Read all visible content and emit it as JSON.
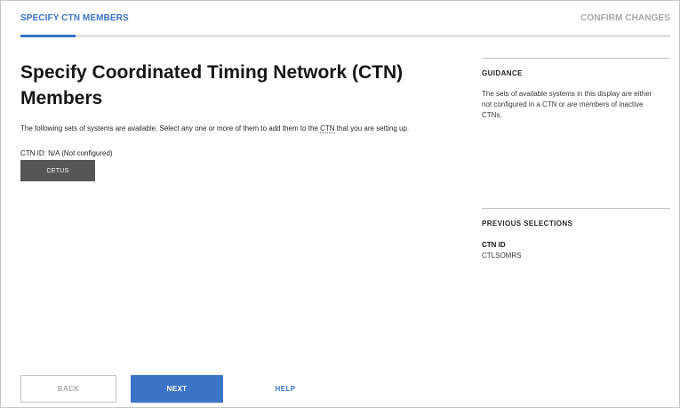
{
  "wizard": {
    "steps": [
      {
        "label": "SPECIFY CTN MEMBERS",
        "active": true
      },
      {
        "label": "CONFIRM CHANGES",
        "active": false
      }
    ],
    "progress_fraction": 0.085
  },
  "main": {
    "title": "Specify Coordinated Timing Network (CTN) Members",
    "description_pre": "The following sets of systems are available. Select any one or more of them to add them to the ",
    "description_abbr": "CTN",
    "description_post": " that you are setting up.",
    "ctn_id_line": "CTN ID: N/A (Not configured)",
    "systems": [
      "CETUS"
    ]
  },
  "guidance": {
    "heading": "GUIDANCE",
    "text": "The sets of available systems in this display are either not configured in a CTN or are members of inactive CTNs."
  },
  "previous_selections": {
    "heading": "PREVIOUS SELECTIONS",
    "label": "CTN ID",
    "value": "CTLSOMRS"
  },
  "footer": {
    "back_label": "BACK",
    "next_label": "NEXT",
    "help_label": "HELP"
  },
  "colors": {
    "accent": "#3b73c7",
    "tile": "#565656",
    "disabled_text": "#a8a8a8"
  }
}
